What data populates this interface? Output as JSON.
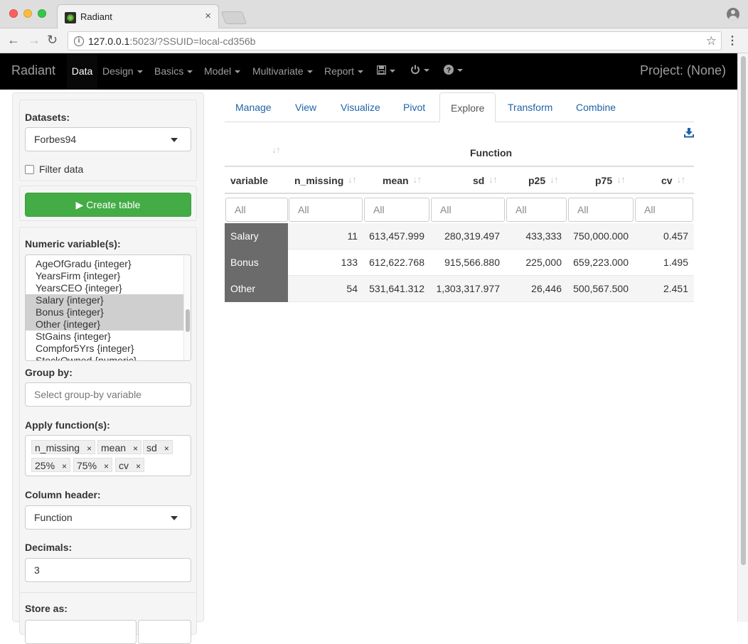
{
  "browser": {
    "tab_title": "Radiant",
    "tab_close": "×",
    "url_host": "127.0.0.1",
    "url_rest": ":5023/?SSUID=local-cd356b"
  },
  "navbar": {
    "brand": "Radiant",
    "items": [
      "Data",
      "Design",
      "Basics",
      "Model",
      "Multivariate",
      "Report"
    ],
    "project": "Project: (None)"
  },
  "sidebar": {
    "datasets_label": "Datasets:",
    "dataset_value": "Forbes94",
    "filter_label": "Filter data",
    "create_label": "▶ Create table",
    "numeric_label": "Numeric variable(s):",
    "numeric_options": [
      "AgeOfGradu {integer}",
      "YearsFirm {integer}",
      "YearsCEO {integer}",
      "Salary {integer}",
      "Bonus {integer}",
      "Other {integer}",
      "StGains {integer}",
      "Compfor5Yrs {integer}",
      "StockOwned {numeric}"
    ],
    "groupby_label": "Group by:",
    "groupby_placeholder": "Select group-by variable",
    "apply_label": "Apply function(s):",
    "functions": [
      "n_missing",
      "mean",
      "sd",
      "25%",
      "75%",
      "cv"
    ],
    "chip_remove": "×",
    "colheader_label": "Column header:",
    "colheader_value": "Function",
    "decimals_label": "Decimals:",
    "decimals_value": "3",
    "store_label": "Store as:"
  },
  "main": {
    "tabs": [
      "Manage",
      "View",
      "Visualize",
      "Pivot",
      "Explore",
      "Transform",
      "Combine"
    ],
    "active_tab": "Explore",
    "table": {
      "group_header": "Function",
      "columns": [
        "variable",
        "n_missing",
        "mean",
        "sd",
        "p25",
        "p75",
        "cv"
      ],
      "filter_placeholder": "All",
      "rows": [
        [
          "Salary",
          "11",
          "613,457.999",
          "280,319.497",
          "433,333",
          "750,000.000",
          "0.457"
        ],
        [
          "Bonus",
          "133",
          "612,622.768",
          "915,566.880",
          "225,000",
          "659,223.000",
          "1.495"
        ],
        [
          "Other",
          "54",
          "531,641.312",
          "1,303,317.977",
          "26,446",
          "500,567.500",
          "2.451"
        ]
      ]
    }
  }
}
